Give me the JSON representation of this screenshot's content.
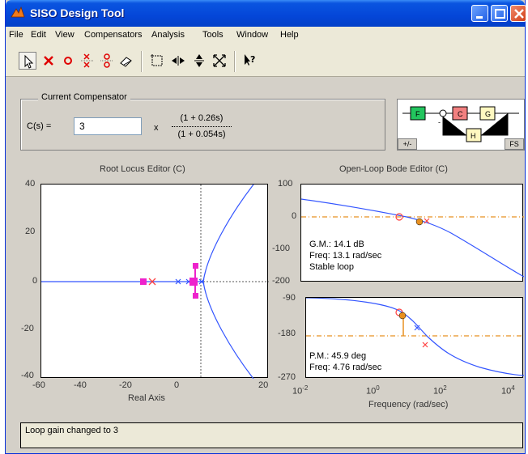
{
  "window": {
    "title": "SISO Design Tool"
  },
  "menu": [
    "File",
    "Edit",
    "View",
    "Compensators",
    "Analysis",
    "Tools",
    "Window",
    "Help"
  ],
  "compensator": {
    "legend": "Current Compensator",
    "label": "C(s) =",
    "gain": "3",
    "times": "x",
    "numerator": "(1 + 0.26s)",
    "denominator": "(1 + 0.054s)"
  },
  "block_diagram": {
    "blocks": [
      "F",
      "C",
      "G",
      "H"
    ],
    "sign": "-",
    "plus_minus_label": "+/-",
    "fs_label": "FS",
    "colors": {
      "F": "#22c55e",
      "C": "#f28080",
      "G": "#fff8c0",
      "H": "#fff8c0"
    }
  },
  "root_locus": {
    "title": "Root Locus Editor (C)",
    "xlabel": "Real Axis",
    "xticks": [
      "-60",
      "-40",
      "-20",
      "0",
      "20"
    ],
    "yticks": [
      "40",
      "20",
      "0",
      "-20",
      "-40"
    ]
  },
  "bode": {
    "title": "Open-Loop Bode Editor (C)",
    "xlabel": "Frequency (rad/sec)",
    "mag_yticks": [
      "100",
      "0",
      "-100",
      "-200"
    ],
    "phase_yticks": [
      "-90",
      "-180",
      "-270"
    ],
    "xticks": [
      {
        "base": "10",
        "exp": "-2"
      },
      {
        "base": "10",
        "exp": "0"
      },
      {
        "base": "10",
        "exp": "2"
      },
      {
        "base": "10",
        "exp": "4"
      }
    ],
    "gain_margin": [
      "G.M.: 14.1 dB",
      "Freq: 13.1 rad/sec",
      "Stable loop"
    ],
    "phase_margin": [
      "P.M.: 45.9 deg",
      "Freq: 4.76 rad/sec"
    ]
  },
  "colors": {
    "locus": "#3355ff",
    "pole": "#ff4040",
    "closed_loop": "#ee22cc",
    "margin": "#e89020"
  },
  "status": "Loop gain changed to 3"
}
